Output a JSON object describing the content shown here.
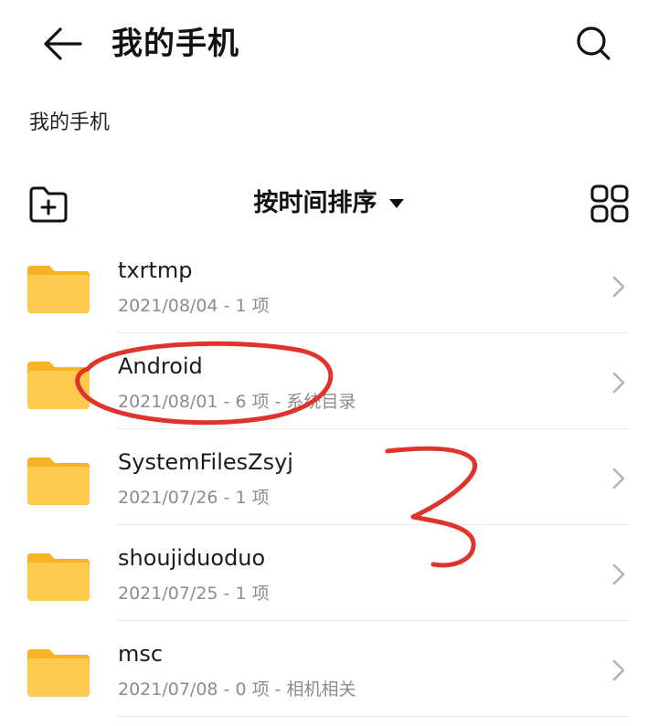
{
  "header": {
    "title": "我的手机",
    "back_icon": "arrow-left-icon",
    "search_icon": "search-icon"
  },
  "breadcrumb": {
    "path": "我的手机"
  },
  "toolbar": {
    "new_folder_icon": "new-folder-icon",
    "sort_label": "按时间排序",
    "sort_icon": "caret-down-icon",
    "view_icon": "grid-view-icon"
  },
  "files": [
    {
      "name": "txrtmp",
      "meta": "2021/08/04 - 1 项"
    },
    {
      "name": "Android",
      "meta": "2021/08/01 - 6 项 - 系统目录"
    },
    {
      "name": "SystemFilesZsyj",
      "meta": "2021/07/26 - 1 项"
    },
    {
      "name": "shoujiduoduo",
      "meta": "2021/07/25 - 1 项"
    },
    {
      "name": "msc",
      "meta": "2021/07/08 - 0 项 - 相机相关"
    }
  ],
  "annotation": {
    "color": "#e0332b",
    "marks": [
      "ellipse-around-android",
      "number-3"
    ]
  },
  "colors": {
    "folder": "#fdc94f",
    "folder_tab": "#f5b325",
    "meta_text": "#8c8c8c",
    "chevron": "#b3b3b3"
  }
}
